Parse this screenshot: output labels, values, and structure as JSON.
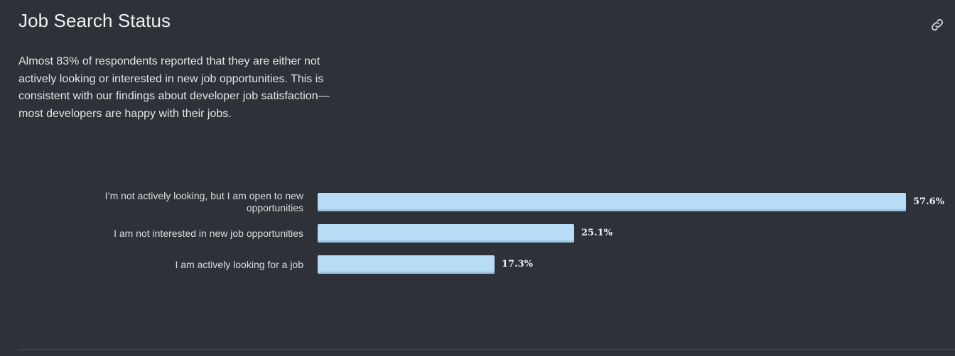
{
  "header": {
    "title": "Job Search Status"
  },
  "description": "Almost 83% of respondents reported that they are either not actively looking or interested in new job opportunities. This is consistent with our findings about developer job satisfaction—most developers are happy with their jobs.",
  "icons": {
    "link": "link-icon"
  },
  "colors": {
    "background": "#2e3137",
    "bar": "#b8dcf6"
  },
  "chart_data": {
    "type": "bar",
    "orientation": "horizontal",
    "categories": [
      "I’m not actively looking, but I am open to new opportunities",
      "I am not interested in new job opportunities",
      "I am actively looking for a job"
    ],
    "values": [
      57.6,
      25.1,
      17.3
    ],
    "value_labels": [
      "57.6%",
      "25.1%",
      "17.3%"
    ],
    "unit": "%",
    "xlim": [
      0,
      57.6
    ],
    "grid": false
  }
}
